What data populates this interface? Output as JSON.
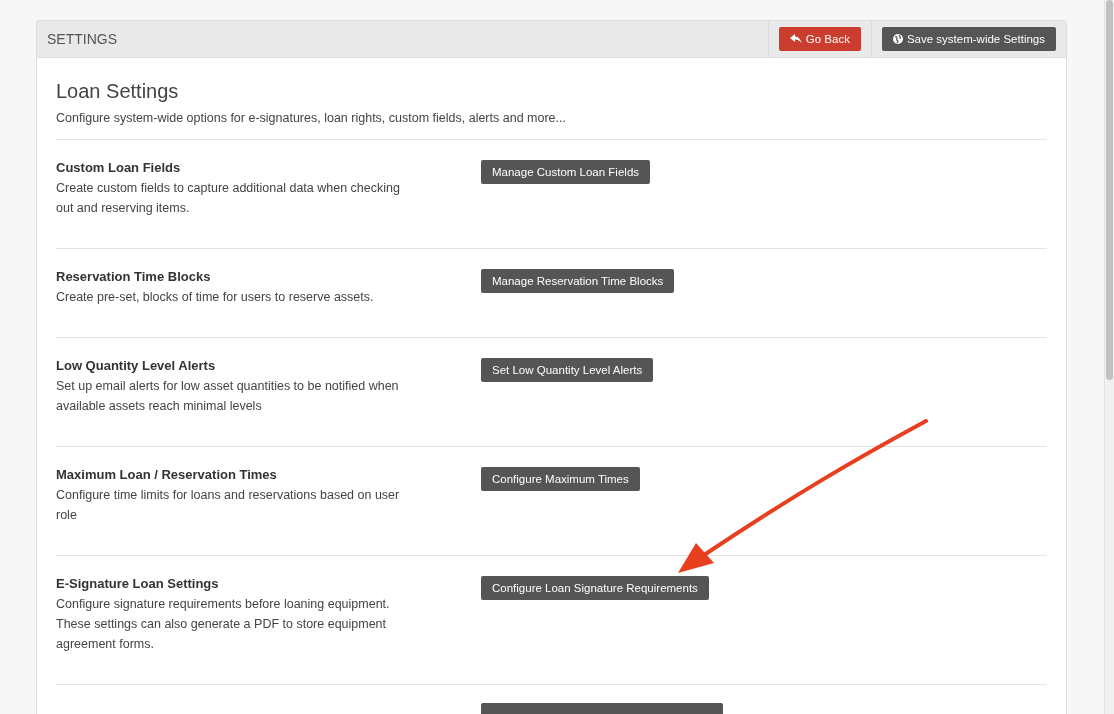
{
  "panel": {
    "title": "SETTINGS",
    "buttons": [
      {
        "kind": "back",
        "label": "Go Back"
      },
      {
        "kind": "save",
        "label": "Save system-wide Settings"
      }
    ]
  },
  "heading": "Loan Settings",
  "intro": "Configure system-wide options for e-signatures, loan rights, custom fields, alerts and more...",
  "rows": [
    {
      "title": "Custom Loan Fields",
      "description": "Create custom fields to capture additional data when checking out and reserving items.",
      "button": "Manage Custom Loan Fields"
    },
    {
      "title": "Reservation Time Blocks",
      "description": "Create pre-set, blocks of time for users to reserve assets.",
      "button": "Manage Reservation Time Blocks"
    },
    {
      "title": "Low Quantity Level Alerts",
      "description": "Set up email alerts for low asset quantities to be notified when available assets reach minimal levels",
      "button": "Set Low Quantity Level Alerts"
    },
    {
      "title": "Maximum Loan / Reservation Times",
      "description": "Configure time limits for loans and reservations based on user role",
      "button": "Configure Maximum Times"
    },
    {
      "title": "E-Signature Loan Settings",
      "description": "Configure signature requirements before loaning equipment. These settings can also generate a PDF to store equipment agreement forms.",
      "button": "Configure Loan Signature Requirements"
    }
  ]
}
